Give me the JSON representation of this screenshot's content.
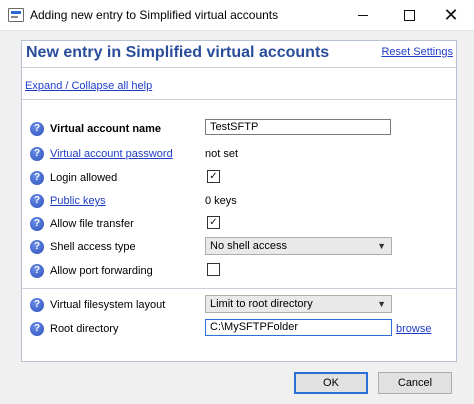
{
  "window": {
    "title": "Adding new entry to Simplified virtual accounts",
    "icon": "app-window-icon",
    "controls": {
      "minimize": "minimize-icon",
      "maximize": "maximize-icon",
      "close": "✕"
    }
  },
  "panel": {
    "title": "New entry in Simplified virtual accounts",
    "reset_label": "Reset Settings",
    "expand_label": "Expand / Collapse all help"
  },
  "help_icon_glyph": "?",
  "fields": {
    "account_name": {
      "label": "Virtual account name",
      "value": "TestSFTP"
    },
    "password": {
      "label": "Virtual account password",
      "value": "not set"
    },
    "login_allowed": {
      "label": "Login allowed",
      "checked": true,
      "mark": "✓"
    },
    "public_keys": {
      "label": "Public keys",
      "value": "0 keys"
    },
    "file_transfer": {
      "label": "Allow file transfer",
      "checked": true,
      "mark": "✓"
    },
    "shell_access": {
      "label": "Shell access type",
      "value": "No shell access"
    },
    "port_forwarding": {
      "label": "Allow port forwarding",
      "checked": false,
      "mark": ""
    },
    "fs_layout": {
      "label": "Virtual filesystem layout",
      "value": "Limit to root directory"
    },
    "root_dir": {
      "label": "Root directory",
      "value": "C:\\MySFTPFolder",
      "browse_label": "browse"
    }
  },
  "buttons": {
    "ok": "OK",
    "cancel": "Cancel"
  },
  "colors": {
    "link": "#1f3ec6",
    "panel_title": "#2a4d9b",
    "help_icon": "#2c4fb8",
    "focus": "#2c6fd6"
  }
}
